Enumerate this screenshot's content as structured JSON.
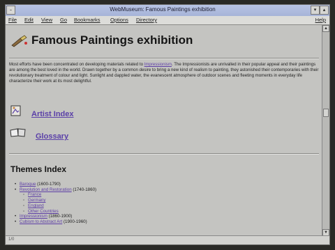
{
  "window": {
    "title": "WebMuseum: Famous Paintings exhibition",
    "sys_menu_glyph": "-",
    "min_glyph": "▾",
    "max_glyph": "▴"
  },
  "menu": {
    "items": [
      "File",
      "Edit",
      "View",
      "Go",
      "Bookmarks",
      "Options",
      "Directory"
    ],
    "help": "Help"
  },
  "page": {
    "title": "Famous Paintings exhibition",
    "intro_before_link": "Most efforts have been concentrated on developing materials related to ",
    "intro_link": "Impressionism",
    "intro_after_link": ". The Impressionists are unrivalled in their popular appeal and their paintings are among the best loved in the world. Drawn together by a common desire to bring a new kind of realism to painting, they astonished their contemporaries with their revolutionary treatment of colour and light. Sunlight and dappled water, the evanescent atmosphere of outdoor scenes and fleeting moments in everyday life characterize their work at its most delightful.",
    "artist_index": "Artist Index",
    "glossary": "Glossary",
    "themes_title": "Themes Index",
    "themes": {
      "baroque": {
        "label": "Baroque",
        "years": " (1600-1790)"
      },
      "revolution": {
        "label": "Revolution and Restoration",
        "years": " (1740-1860)"
      },
      "sub": [
        "France",
        "Germany",
        "England",
        "Other Countries"
      ],
      "impressionism": {
        "label": "Impressionism",
        "years": " (1860-1900)"
      },
      "cubism": {
        "label": "Cubism to Abstract Art",
        "years": " (1900-1960)"
      }
    }
  },
  "status": {
    "text": "1/0"
  },
  "colors": {
    "link": "#5d3ea6",
    "background": "#c4c4c1",
    "titlebar": "#a6b4d8"
  }
}
